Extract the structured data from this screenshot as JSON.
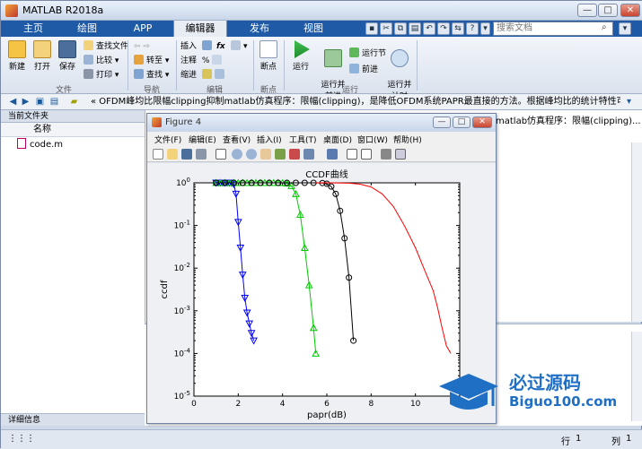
{
  "window": {
    "title": "MATLAB R2018a"
  },
  "tabs": [
    {
      "label": "主页"
    },
    {
      "label": "绘图"
    },
    {
      "label": "APP"
    },
    {
      "label": "编辑器"
    },
    {
      "label": "发布"
    },
    {
      "label": "视图"
    }
  ],
  "search": {
    "placeholder": "搜索文档"
  },
  "ribbon": {
    "file_group": {
      "label": "文件",
      "new": "新建",
      "open": "打开",
      "save": "保存",
      "find_files": "查找文件",
      "compare": "比较",
      "print": "打印"
    },
    "nav_group": {
      "label": "导航",
      "goto": "转至",
      "find": "查找"
    },
    "edit_group": {
      "label": "编辑",
      "insert": "插入",
      "comment": "注释",
      "indent": "缩进",
      "fx": "fx"
    },
    "bp_group": {
      "label": "断点",
      "breakpoints": "断点"
    },
    "run_group": {
      "label": "运行",
      "run": "运行",
      "run_advance": "运行并\n前进",
      "run_section": "运行节",
      "advance": "前进",
      "run_time": "运行并\n计时"
    }
  },
  "address": {
    "path": "« OFDM峰均比限幅clipping抑制matlab仿真程序：限幅(clipping)，是降低OFDM系统PAPR最直接的方法。根据峰均比的统计特性可知，高峰平比出现的概..."
  },
  "current_folder": {
    "header": "当前文件夹",
    "col_name": "名称",
    "files": [
      "code.m"
    ],
    "details": "详细信息"
  },
  "editor": {
    "tab_text": "matlab仿真程序：限幅(clipping)..."
  },
  "status": {
    "row_label": "行",
    "row": "1",
    "col_label": "列",
    "col": "1"
  },
  "figure": {
    "title": "Figure 4",
    "menu": [
      "文件(F)",
      "编辑(E)",
      "查看(V)",
      "插入(I)",
      "工具(T)",
      "桌面(D)",
      "窗口(W)",
      "帮助(H)"
    ]
  },
  "watermark": {
    "text": "必过源码",
    "url": "Biguo100.com"
  },
  "chart_data": {
    "type": "line",
    "title": "CCDF曲线",
    "xlabel": "papr(dB)",
    "ylabel": "ccdf",
    "xlim": [
      0,
      12
    ],
    "ylim_log10": [
      -5,
      0
    ],
    "xticks": [
      0,
      2,
      4,
      6,
      8,
      10,
      12
    ],
    "ytick_labels": [
      "10^0",
      "10^-1",
      "10^-2",
      "10^-3",
      "10^-4",
      "10^-5"
    ],
    "yscale": "log",
    "grid": false,
    "series": [
      {
        "color": "#0000ff",
        "marker": "triangle-down",
        "x": [
          1.0,
          1.1,
          1.2,
          1.3,
          1.4,
          1.5,
          1.6,
          1.7,
          1.8,
          1.9,
          2.0,
          2.1,
          2.2,
          2.3,
          2.4,
          2.5,
          2.6,
          2.7
        ],
        "y": [
          1,
          1,
          1,
          1,
          1,
          1,
          0.999,
          0.99,
          0.93,
          0.55,
          0.12,
          0.03,
          0.007,
          0.002,
          0.0009,
          0.0005,
          0.0003,
          0.0002
        ]
      },
      {
        "color": "#00cc00",
        "marker": "triangle-up",
        "x": [
          1.0,
          1.2,
          1.4,
          1.6,
          1.8,
          2.0,
          2.2,
          2.4,
          2.6,
          2.8,
          3.0,
          3.2,
          3.4,
          3.6,
          3.8,
          4.0,
          4.2,
          4.4,
          4.6,
          4.8,
          5.0,
          5.2,
          5.4,
          5.5
        ],
        "y": [
          1,
          1,
          1,
          1,
          1,
          1,
          1,
          1,
          1,
          1,
          1,
          1,
          1,
          1,
          1,
          0.995,
          0.97,
          0.85,
          0.55,
          0.18,
          0.03,
          0.004,
          0.0004,
          0.0001
        ]
      },
      {
        "color": "#000000",
        "marker": "circle",
        "x": [
          1.0,
          1.4,
          1.8,
          2.2,
          2.6,
          3.0,
          3.4,
          3.8,
          4.2,
          4.6,
          5.0,
          5.4,
          5.8,
          6.0,
          6.2,
          6.4,
          6.6,
          6.8,
          7.0,
          7.2
        ],
        "y": [
          1,
          1,
          1,
          1,
          1,
          1,
          1,
          1,
          1,
          1,
          1,
          1,
          0.99,
          0.95,
          0.82,
          0.55,
          0.22,
          0.05,
          0.006,
          0.0002
        ]
      },
      {
        "color": "#ff0000",
        "marker": "none",
        "x": [
          5.5,
          6.0,
          6.5,
          7.0,
          7.5,
          8.0,
          8.5,
          9.0,
          9.5,
          10.0,
          10.5,
          10.8,
          11.0,
          11.2,
          11.4,
          11.6
        ],
        "y": [
          1,
          1,
          0.995,
          0.98,
          0.93,
          0.8,
          0.55,
          0.28,
          0.1,
          0.03,
          0.007,
          0.003,
          0.0012,
          0.0004,
          0.00015,
          0.0001
        ]
      }
    ]
  }
}
